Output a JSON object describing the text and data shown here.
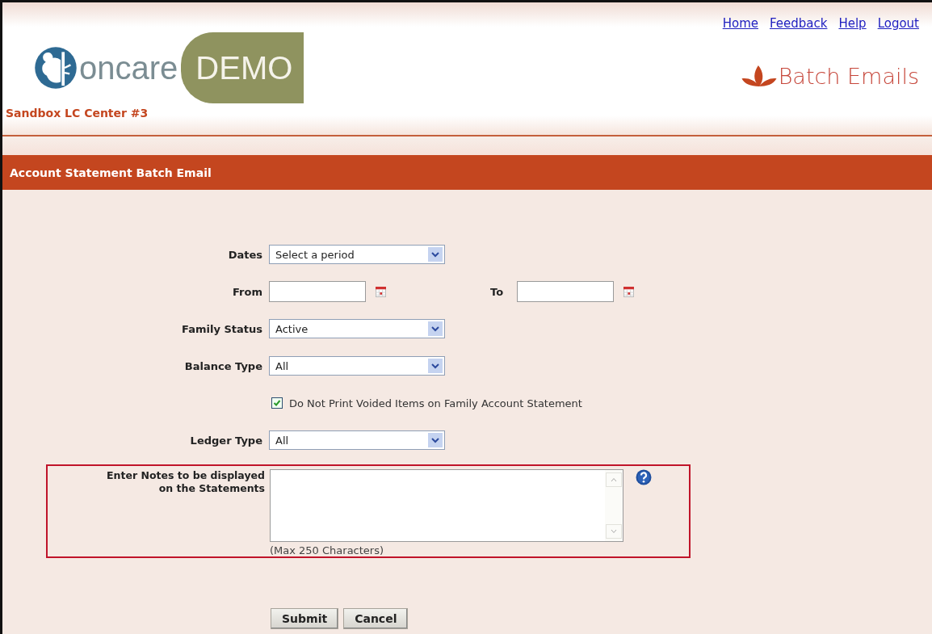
{
  "header": {
    "links": [
      "Home",
      "Feedback",
      "Help",
      "Logout"
    ],
    "logo": {
      "brand": "oncare",
      "tag": "DEMO"
    },
    "center_name": "Sandbox LC Center #3",
    "module_title": "Batch Emails"
  },
  "section_title": "Account Statement Batch Email",
  "fields": [
    {
      "kind": "select",
      "label": "Dates",
      "value": "Select a period"
    },
    {
      "kind": "daterange",
      "from_label": "From",
      "to_label": "To"
    },
    {
      "kind": "select",
      "label": "Family Status",
      "value": "Active"
    },
    {
      "kind": "select",
      "label": "Balance Type",
      "value": "All"
    },
    {
      "kind": "checkbox",
      "text": "Do Not Print Voided Items on Family Account Statement",
      "checked": true
    },
    {
      "kind": "select",
      "label": "Ledger Type",
      "value": "All"
    }
  ],
  "notes": {
    "label": "Enter Notes to be displayed on the Statements",
    "hint": "(Max 250 Characters)"
  },
  "buttons": [
    "Submit",
    "Cancel"
  ]
}
